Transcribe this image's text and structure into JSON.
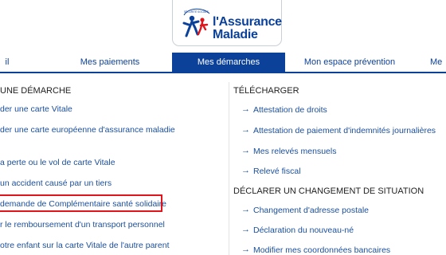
{
  "logo": {
    "name_line1": "l'Assurance",
    "name_line2": "Maladie",
    "tagline": "SÉCURITÉ SOCIALE"
  },
  "nav": {
    "items": [
      {
        "label": "il"
      },
      {
        "label": "Mes paiements"
      },
      {
        "label": "Mes démarches",
        "active": true
      },
      {
        "label": "Mon espace prévention"
      },
      {
        "label": "Me"
      }
    ]
  },
  "left_column": {
    "section_title": "UNE DÉMARCHE",
    "links": [
      "der une carte Vitale",
      "der une carte européenne d'assurance maladie",
      "a perte ou le vol de carte Vitale",
      "un accident causé par un tiers",
      "demande de Complémentaire santé solidaire",
      "r le remboursement d'un transport personnel",
      "otre enfant sur la carte Vitale de l'autre parent"
    ]
  },
  "right_column": {
    "download_title": "TÉLÉCHARGER",
    "download_links": [
      "Attestation de droits",
      "Attestation de paiement d'indemnités journalières",
      "Mes relevés mensuels",
      "Relevé fiscal"
    ],
    "declare_title": "DÉCLARER UN CHANGEMENT DE SITUATION",
    "declare_links": [
      "Changement d'adresse postale",
      "Déclaration du nouveau-né",
      "Modifier mes coordonnées bancaires"
    ]
  },
  "colors": {
    "brand_blue": "#0c419a",
    "link_blue": "#1a4f9c",
    "highlight_red": "#e0141b"
  },
  "icons": {
    "link_arrow": "→"
  }
}
